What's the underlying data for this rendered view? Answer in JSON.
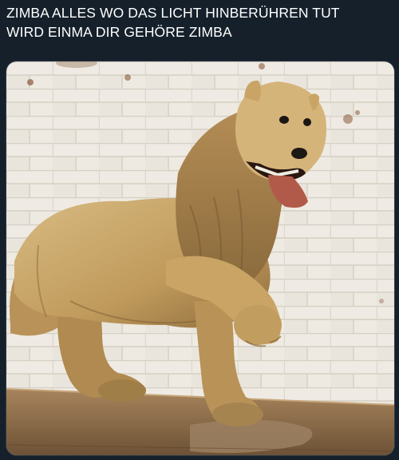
{
  "tweet": {
    "caption_line1": "ZIMBA ALLES WO DAS LICHT HINBERÜHREN TUT",
    "caption_line2": "WIRD EINMA DIR GEHÖRE ZIMBA"
  },
  "photo": {
    "subject": "stuffed-lion-photo"
  },
  "colors": {
    "background": "#15202b",
    "text": "#ffffff",
    "wall": "#e8e4dc",
    "fur": "#c9a86b"
  }
}
